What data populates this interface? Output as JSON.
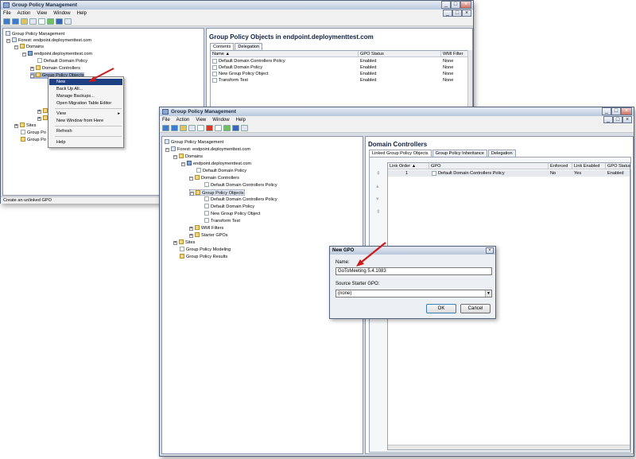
{
  "back_window": {
    "title": "Group Policy Management",
    "menu": [
      "File",
      "Action",
      "View",
      "Window",
      "Help"
    ],
    "window_controls": [
      "_",
      "□",
      "×"
    ],
    "tree": [
      "Group Policy Management",
      "Forest: endpoint.deploymenttest.com",
      "Domains",
      "endpoint.deploymenttest.com",
      "Default Domain Policy",
      "Domain Controllers",
      "Group Policy Objects",
      "W",
      "S",
      "Sites",
      "Group Po",
      "Group Po"
    ],
    "right_header": "Group Policy Objects in endpoint.deploymenttest.com",
    "tabs": [
      "Contents",
      "Delegation"
    ],
    "columns": [
      "Name",
      "GPO Status",
      "WMI Filter"
    ],
    "rows": [
      [
        "Default Domain Controllers Policy",
        "Enabled",
        "None"
      ],
      [
        "Default Domain Policy",
        "Enabled",
        "None"
      ],
      [
        "New Group Policy Object",
        "Enabled",
        "None"
      ],
      [
        "Transform Test",
        "Enabled",
        "None"
      ]
    ],
    "status": "Create an unlinked GPO"
  },
  "context_menu": {
    "items": [
      "New",
      "Back Up All...",
      "Manage Backups...",
      "Open Migration Table Editor",
      "View",
      "New Window from Here",
      "Refresh",
      "Help"
    ]
  },
  "front_window": {
    "title": "Group Policy Management",
    "menu": [
      "File",
      "Action",
      "View",
      "Window",
      "Help"
    ],
    "window_controls": [
      "_",
      "□",
      "×"
    ],
    "tree": [
      "Group Policy Management",
      "Forest: endpoint.deploymenttest.com",
      "Domains",
      "endpoint.deploymenttest.com",
      "Default Domain Policy",
      "Domain Controllers",
      "Default Domain Controllers Policy",
      "Group Policy Objects",
      "Default Domain Controllers Policy",
      "Default Domain Policy",
      "New Group Policy Object",
      "Transform Test",
      "WMI Filters",
      "Starter GPOs",
      "Sites",
      "Group Policy Modeling",
      "Group Policy Results"
    ],
    "right_header": "Domain Controllers",
    "tabs": [
      "Linked Group Policy Objects",
      "Group Policy Inheritance",
      "Delegation"
    ],
    "columns": [
      "Link Order",
      "GPO",
      "Enforced",
      "Link Enabled",
      "GPO Status"
    ],
    "rows": [
      [
        "1",
        "Default Domain Controllers Policy",
        "No",
        "Yes",
        "Enabled"
      ]
    ]
  },
  "dialog": {
    "title": "New GPO",
    "name_label": "Name:",
    "name_value": "GoToMeeting 5.4.1083",
    "starter_label": "Source Starter GPO:",
    "starter_value": "(none)",
    "ok": "OK",
    "cancel": "Cancel"
  },
  "colors": {
    "arrow": "#cc1a1a",
    "selection": "#1f3f83"
  }
}
